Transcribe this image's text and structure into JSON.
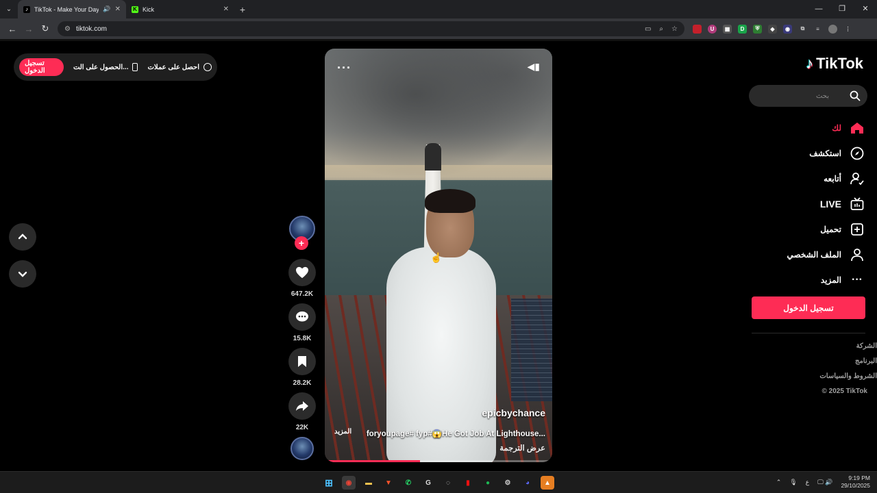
{
  "browser": {
    "tabs": [
      {
        "title": "TikTok - Make Your Day",
        "active": true
      },
      {
        "title": "Kick",
        "active": false
      }
    ],
    "url": "tiktok.com"
  },
  "pill": {
    "login": "تسجيل الدخول",
    "get_app": "الحصول على الت...",
    "get_coins": "احصل على عملات"
  },
  "video": {
    "author": "epicbychance",
    "caption": "foryoupage# fyp#😱He Got Job At Lighthouse...",
    "more": "المزيد",
    "translate": "عرض الترجمة",
    "progress": 0.42
  },
  "actions": {
    "likes": "647.2K",
    "comments": "15.8K",
    "saves": "28.2K",
    "shares": "22K"
  },
  "sidebar": {
    "logo": "TikTok",
    "search_placeholder": "بحث",
    "items": [
      {
        "label": "لك",
        "icon": "home-icon"
      },
      {
        "label": "استكشف",
        "icon": "compass-icon"
      },
      {
        "label": "أتابعه",
        "icon": "following-icon"
      },
      {
        "label": "LIVE",
        "icon": "live-icon"
      },
      {
        "label": "تحميل",
        "icon": "upload-icon"
      },
      {
        "label": "الملف الشخصي",
        "icon": "profile-icon"
      },
      {
        "label": "المزيد",
        "icon": "more-icon"
      }
    ],
    "login": "تسجيل الدخول",
    "footer": [
      "الشركة",
      "البرنامج",
      "الشروط والسياسات",
      "© 2025 TikTok"
    ]
  },
  "taskbar": {
    "time": "9:19 PM",
    "date": "29/10/2025",
    "lang": "ع"
  },
  "colors": {
    "accent": "#fe2c55"
  }
}
